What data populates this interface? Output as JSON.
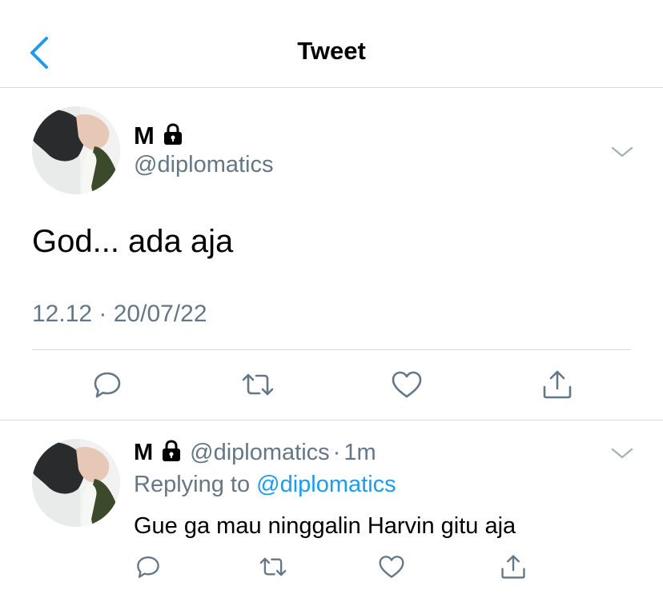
{
  "header": {
    "title": "Tweet",
    "back_icon": "chevron-left-icon",
    "accent_color": "#1d9bf0"
  },
  "main_tweet": {
    "name": "M",
    "lock_icon": "lock-icon",
    "handle": "@diplomatics",
    "text": "God... ada aja",
    "timestamp": "12.12 · 20/07/22",
    "actions": [
      "reply-icon",
      "retweet-icon",
      "like-icon",
      "share-icon"
    ]
  },
  "reply_tweet": {
    "name": "M",
    "lock_icon": "lock-icon",
    "handle": "@diplomatics",
    "separator": "·",
    "age": "1m",
    "replying_prefix": "Replying to",
    "replying_to": "@diplomatics",
    "text": "Gue ga mau ninggalin Harvin gitu aja",
    "actions": [
      "reply-icon",
      "retweet-icon",
      "like-icon",
      "share-icon"
    ]
  },
  "colors": {
    "secondary_text": "#657786",
    "icon": "#657786",
    "link": "#1d9bf0",
    "divider": "#d8dce0"
  }
}
